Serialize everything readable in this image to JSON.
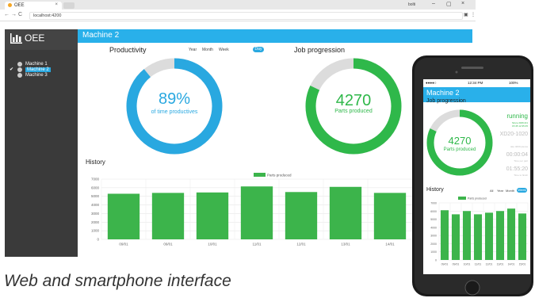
{
  "browser": {
    "tab_title": "OEE",
    "tab_close": "×",
    "url": "localhost:4200",
    "user_label": "bolti",
    "win_min": "–",
    "win_max": "▢",
    "win_close": "×",
    "nav_back": "←",
    "nav_fwd": "→",
    "nav_reload": "C"
  },
  "sidebar": {
    "brand": "OEE",
    "machines": [
      {
        "label": "Machine 1",
        "checked": ""
      },
      {
        "label": "Machine 2",
        "checked": "✔"
      },
      {
        "label": "Machine 3",
        "checked": ""
      }
    ]
  },
  "header": {
    "title": "Machine 2"
  },
  "productivity": {
    "title": "Productivity",
    "tabs": [
      "Year",
      "Month",
      "Week",
      "Day"
    ],
    "value": "89%",
    "subtitle": "of time productives",
    "fraction": 0.89
  },
  "job": {
    "title": "Job progression",
    "value": "4270",
    "subtitle": "Parts produced",
    "fraction": 0.82
  },
  "history": {
    "title": "History"
  },
  "chart_data": [
    {
      "type": "bar",
      "legend": "Parts produced",
      "categories": [
        "09/01",
        "09/01",
        "10/01",
        "11/01",
        "12/01",
        "13/01",
        "14/01"
      ],
      "values": [
        5300,
        5400,
        5450,
        6150,
        5500,
        6100,
        5400
      ],
      "yticks": [
        0,
        1000,
        2000,
        3000,
        4000,
        5000,
        6000,
        7000
      ],
      "ylim": [
        0,
        7000
      ],
      "color": "#3cb44b"
    },
    {
      "type": "bar",
      "legend": "Parts produced",
      "categories": [
        "09/01",
        "09/01",
        "10/01",
        "11/01",
        "12/01",
        "13/01",
        "14/01",
        "15/01"
      ],
      "values": [
        6100,
        5600,
        6000,
        5600,
        5800,
        6000,
        6300,
        5700
      ],
      "yticks": [
        0,
        1000,
        2000,
        3000,
        4000,
        5000,
        6000,
        7000
      ],
      "ylim": [
        0,
        7000
      ],
      "color": "#3cb44b"
    }
  ],
  "phone": {
    "status_left": "●●●●○",
    "time": "12:34 PM",
    "battery": "100%",
    "title": "Machine 2",
    "section": "Job progression",
    "value": "4270",
    "subtitle": "Parts produced",
    "state": "running",
    "state_detail1": "Since 29/01/21",
    "state_detail2": "15:45 12:35:45",
    "order": "XD20-1020",
    "order_sub": "rate 4000 pieces",
    "time1": "00:00:04",
    "time1_sub": "Time per part",
    "time2": "01:55:20",
    "time2_sub": "Time to finish",
    "history_title": "History",
    "tabs": [
      "All",
      "Year",
      "Month",
      "Week"
    ],
    "fraction": 0.82
  },
  "caption": "Web and smartphone interface"
}
